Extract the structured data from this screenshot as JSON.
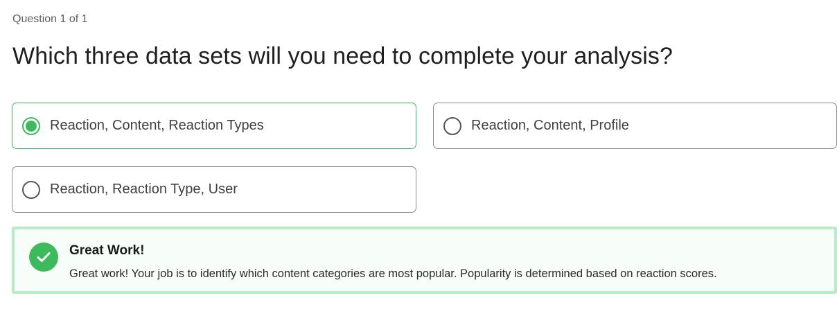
{
  "quiz": {
    "counter": "Question 1 of 1",
    "question": "Which three data sets will you need to complete your analysis?",
    "options": [
      {
        "label": "Reaction, Content, Reaction Types",
        "selected": true
      },
      {
        "label": "Reaction, Content, Profile",
        "selected": false
      },
      {
        "label": "Reaction, Reaction Type, User",
        "selected": false
      }
    ]
  },
  "feedback": {
    "icon": "checkmark-icon",
    "title": "Great Work!",
    "body": "Great work! Your job is to identify which content categories are most popular. Popularity is determined based on reaction scores."
  },
  "colors": {
    "accent": "#3dbb5c",
    "feedback_border": "#b8ecc4",
    "feedback_bg": "#f7fdf8"
  }
}
